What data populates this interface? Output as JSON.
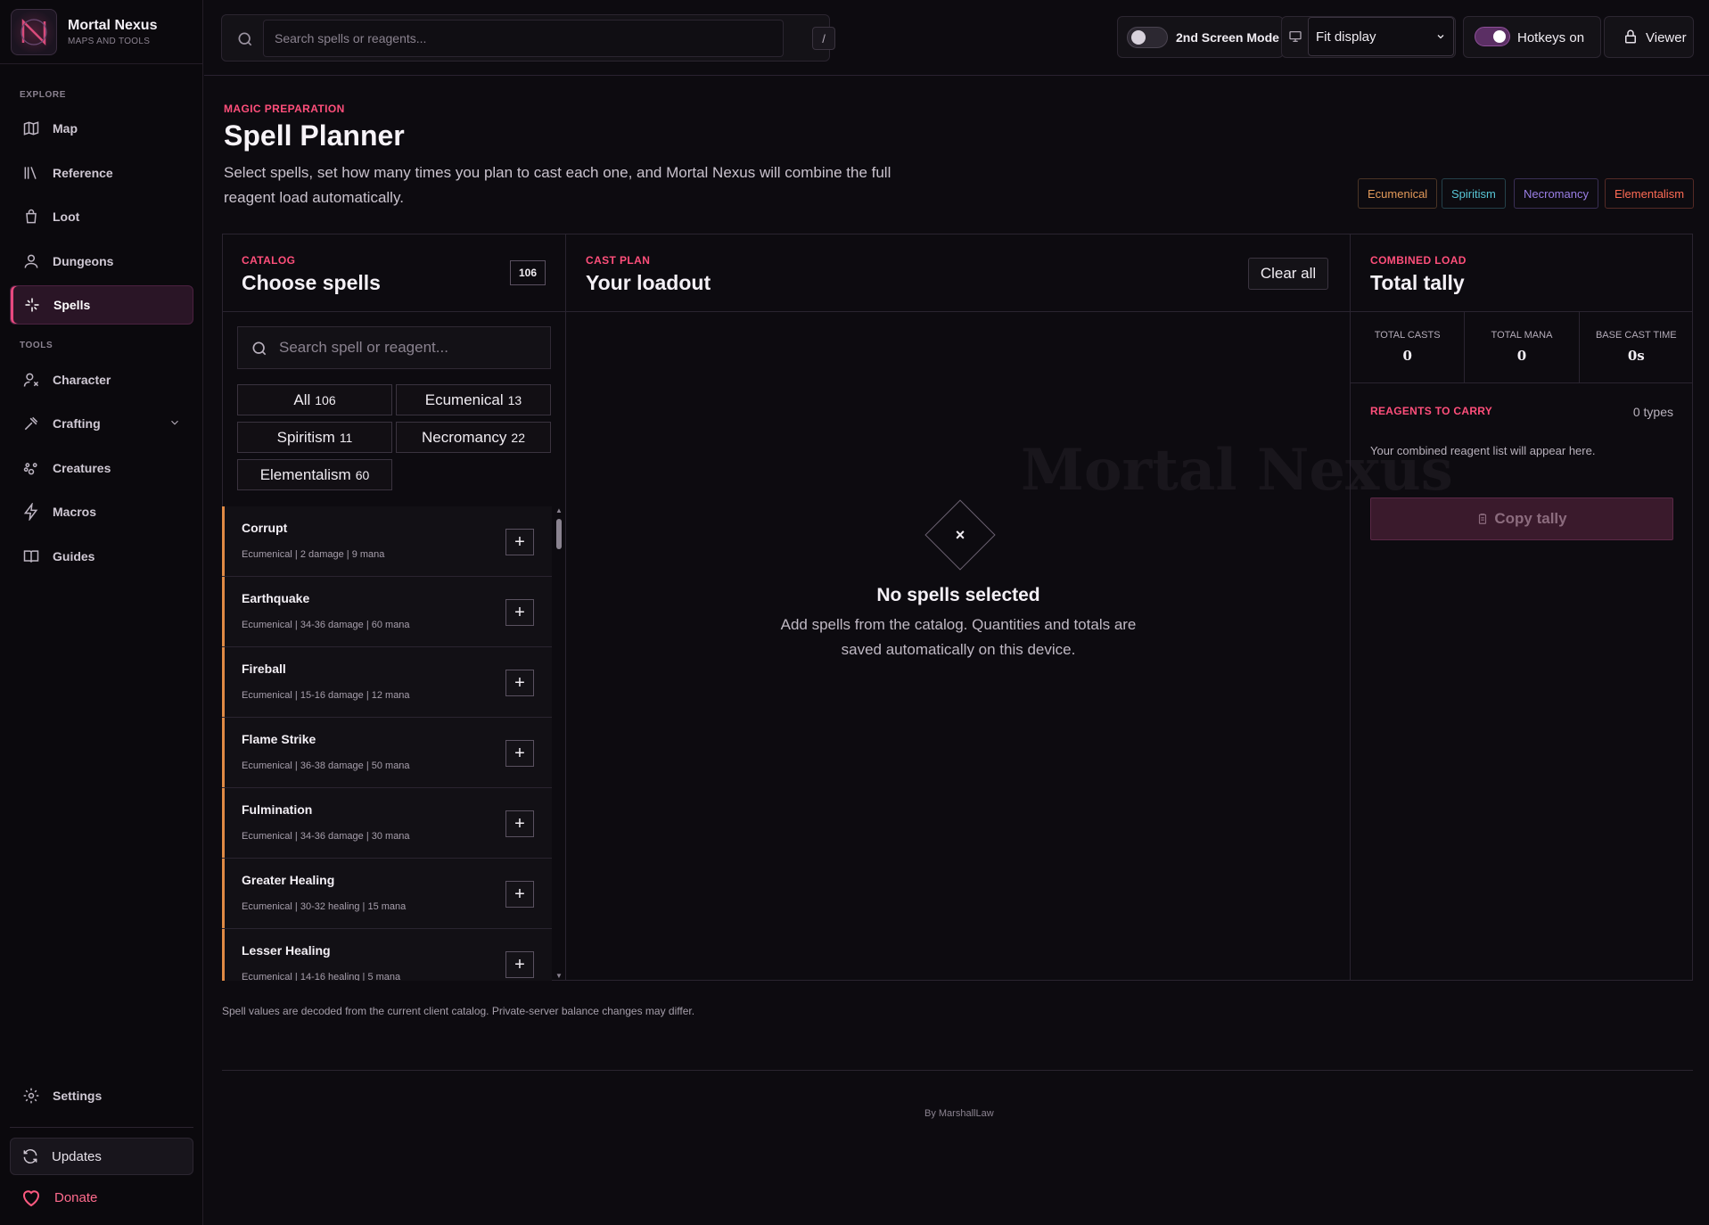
{
  "brand": {
    "title": "Mortal Nexus",
    "subtitle": "MAPS AND TOOLS"
  },
  "sidebar": {
    "explore_label": "EXPLORE",
    "tools_label": "TOOLS",
    "items": [
      {
        "label": "Map",
        "icon": "map-icon"
      },
      {
        "label": "Reference",
        "icon": "book-icon"
      },
      {
        "label": "Loot",
        "icon": "bag-icon"
      },
      {
        "label": "Dungeons",
        "icon": "user-icon"
      },
      {
        "label": "Spells",
        "icon": "sparkle-icon",
        "active": true
      },
      {
        "label": "Character",
        "icon": "character-icon"
      },
      {
        "label": "Crafting",
        "icon": "hammer-icon"
      },
      {
        "label": "Creatures",
        "icon": "paw-icon"
      },
      {
        "label": "Macros",
        "icon": "bolt-icon"
      },
      {
        "label": "Guides",
        "icon": "open-book-icon"
      }
    ],
    "settings_label": "Settings",
    "updates_label": "Updates",
    "donate_label": "Donate"
  },
  "topbar": {
    "search_placeholder": "Search spells or reagents...",
    "search_shortcut": "/",
    "second_screen_label": "2nd Screen Mode",
    "second_screen_on": false,
    "display_select_value": "Fit display",
    "hotkeys_label": "Hotkeys on",
    "hotkeys_on": true,
    "viewer_label": "Viewer"
  },
  "header": {
    "eyebrow": "MAGIC PREPARATION",
    "title": "Spell Planner",
    "description": "Select spells, set how many times you plan to cast each one, and Mortal Nexus will combine the full reagent load automatically.",
    "schools": [
      {
        "label": "Ecumenical",
        "color": "#e39a5a"
      },
      {
        "label": "Spiritism",
        "color": "#58c6d6"
      },
      {
        "label": "Necromancy",
        "color": "#9b7fe6"
      },
      {
        "label": "Elementalism",
        "color": "#ff6b55"
      }
    ]
  },
  "catalog": {
    "eyebrow": "CATALOG",
    "title": "Choose spells",
    "count": "106",
    "search_placeholder": "Search spell or reagent...",
    "filters": [
      {
        "label": "All",
        "count": "106"
      },
      {
        "label": "Ecumenical",
        "count": "13"
      },
      {
        "label": "Spiritism",
        "count": "11"
      },
      {
        "label": "Necromancy",
        "count": "22"
      },
      {
        "label": "Elementalism",
        "count": "60"
      }
    ],
    "spells": [
      {
        "name": "Corrupt",
        "meta": "Ecumenical | 2 damage | 9 mana"
      },
      {
        "name": "Earthquake",
        "meta": "Ecumenical | 34-36 damage | 60 mana"
      },
      {
        "name": "Fireball",
        "meta": "Ecumenical | 15-16 damage | 12 mana"
      },
      {
        "name": "Flame Strike",
        "meta": "Ecumenical | 36-38 damage | 50 mana"
      },
      {
        "name": "Fulmination",
        "meta": "Ecumenical | 34-36 damage | 30 mana"
      },
      {
        "name": "Greater Healing",
        "meta": "Ecumenical | 30-32 healing | 15 mana"
      },
      {
        "name": "Lesser Healing",
        "meta": "Ecumenical | 14-16 healing | 5 mana"
      }
    ],
    "add_label": "+"
  },
  "plan": {
    "eyebrow": "CAST PLAN",
    "title": "Your loadout",
    "clear_label": "Clear all",
    "empty_symbol": "×",
    "empty_title": "No spells selected",
    "empty_desc": "Add spells from the catalog. Quantities and totals are saved automatically on this device."
  },
  "tally": {
    "eyebrow": "COMBINED LOAD",
    "title": "Total tally",
    "stats": [
      {
        "label": "TOTAL CASTS",
        "value": "0"
      },
      {
        "label": "TOTAL MANA",
        "value": "0"
      },
      {
        "label": "BASE CAST TIME",
        "value": "0s"
      }
    ],
    "reagents_label": "REAGENTS TO CARRY",
    "reagents_types": "0 types",
    "reagents_empty": "Your combined reagent list will appear here.",
    "copy_label": "Copy tally"
  },
  "footer": {
    "note": "Spell values are decoded from the current client catalog. Private-server balance changes may differ.",
    "byline": "By MarshallLaw"
  }
}
